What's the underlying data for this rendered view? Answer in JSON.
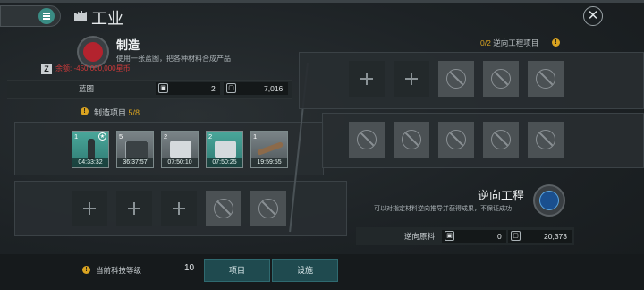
{
  "header": {
    "title": "工业",
    "close_glyph": "✕"
  },
  "manufacture": {
    "title": "制造",
    "description": "使用一张蓝图，把各种材料合成产品",
    "balance_label": "余额:",
    "balance_value": "-450,000,000星币",
    "badge": "Z",
    "blueprint_label": "蓝图",
    "blueprint_count": "2",
    "blueprint_total": "7,016",
    "items_label": "制造项目",
    "items_count": "5/8",
    "slots": [
      {
        "count": "1",
        "time": "04:33:32",
        "style": "teal",
        "starred": true
      },
      {
        "count": "5",
        "time": "36:37:57",
        "style": "gray",
        "starred": false
      },
      {
        "count": "2",
        "time": "07:50:10",
        "style": "gray",
        "starred": false
      },
      {
        "count": "2",
        "time": "07:50:25",
        "style": "teal",
        "starred": false
      },
      {
        "count": "1",
        "time": "19:59:55",
        "style": "gray",
        "starred": false
      }
    ]
  },
  "reverse": {
    "count": "0/2",
    "head_label": "逆向工程项目",
    "title": "逆向工程",
    "description": "可以对指定材料逆向推导并获得成果，不保证成功",
    "material_label": "逆向原料",
    "material_count": "0",
    "material_total": "20,373"
  },
  "footer": {
    "tech_label": "当前科技等级",
    "tech_value": "10",
    "btn_projects": "项目",
    "btn_facilities": "设施"
  },
  "colors": {
    "accent": "#3a8c84",
    "warning": "#d9a321",
    "negative": "#d03a3a"
  }
}
